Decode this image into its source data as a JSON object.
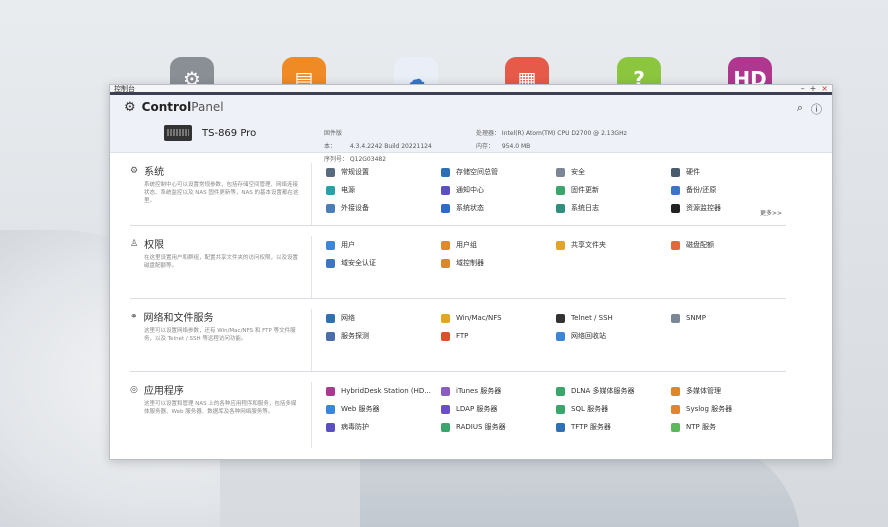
{
  "window": {
    "title": "控制台",
    "controls": [
      "–",
      "+",
      "×"
    ]
  },
  "header": {
    "app_title_bold": "Control",
    "app_title_light": "Panel",
    "search_icon": "search-icon",
    "help_icon": "help-icon",
    "device_name": "TS-869 Pro",
    "info_left": [
      {
        "key": "固件版本：",
        "value": "4.3.4.2242 Build 20221124"
      },
      {
        "key": "序列号：",
        "value": "Q12G03482"
      }
    ],
    "info_right": [
      {
        "key": "处理器：",
        "value": "Intel(R) Atom(TM) CPU D2700 @ 2.13GHz"
      },
      {
        "key": "内存：",
        "value": "954.0 MB"
      }
    ]
  },
  "sections": [
    {
      "id": "system",
      "icon": "gear-icon",
      "title": "系统",
      "desc": "系统控制中心可以设置常规参数，包括存储空间管理、网络连接状态、系统监控以及 NAS 固件更新等，NAS 的基本设置都在这里。",
      "items": [
        {
          "label": "常规设置",
          "color": "#5a6b7f"
        },
        {
          "label": "存储空间总管",
          "color": "#2f6fb3"
        },
        {
          "label": "安全",
          "color": "#7b8794"
        },
        {
          "label": "硬件",
          "color": "#4a5b6e"
        },
        {
          "label": "电源",
          "color": "#2aa1a8"
        },
        {
          "label": "通知中心",
          "color": "#5b4fc4"
        },
        {
          "label": "固件更新",
          "color": "#3aa66b"
        },
        {
          "label": "备份/还原",
          "color": "#3b74c9"
        },
        {
          "label": "外接设备",
          "color": "#4c7fb8"
        },
        {
          "label": "系统状态",
          "color": "#2d6cc0"
        },
        {
          "label": "系统日志",
          "color": "#2f8f7a"
        },
        {
          "label": "资源监控器",
          "color": "#222222"
        }
      ],
      "more": "更多>>"
    },
    {
      "id": "privilege",
      "icon": "user-icon",
      "title": "权限",
      "desc": "在这里设置用户和群组，配置共享文件夹的访问权限，以及设置磁盘配额等。",
      "items": [
        {
          "label": "用户",
          "color": "#3b86d9"
        },
        {
          "label": "用户组",
          "color": "#e08a2a"
        },
        {
          "label": "共享文件夹",
          "color": "#e0a52a"
        },
        {
          "label": "磁盘配额",
          "color": "#e06a3a"
        },
        {
          "label": "域安全认证",
          "color": "#3b74c9"
        },
        {
          "label": "域控制器",
          "color": "#e0862a"
        }
      ]
    },
    {
      "id": "network",
      "icon": "network-icon",
      "title": "网络和文件服务",
      "desc": "这里可以设置网络参数，还有 Win/Mac/NFS 和 FTP 等文件服务，以及 Telnet / SSH 等远程访问功能。",
      "items": [
        {
          "label": "网络",
          "color": "#2f6fb3"
        },
        {
          "label": "Win/Mac/NFS",
          "color": "#e0a52a"
        },
        {
          "label": "Telnet / SSH",
          "color": "#333333"
        },
        {
          "label": "SNMP",
          "color": "#7b8794"
        },
        {
          "label": "服务探测",
          "color": "#4a6ea8"
        },
        {
          "label": "FTP",
          "color": "#d9532a"
        },
        {
          "label": "网络回收站",
          "color": "#3b86d9"
        }
      ]
    },
    {
      "id": "applications",
      "icon": "apps-icon",
      "title": "应用程序",
      "desc": "这里可以设置和管理 NAS 上的各种应用程序和服务，包括多媒体服务器、Web 服务器、数据库及各种网络服务等。",
      "items": [
        {
          "label": "HybridDesk Station (HD...",
          "color": "#b0378f"
        },
        {
          "label": "iTunes 服务器",
          "color": "#8b5cc4"
        },
        {
          "label": "DLNA 多媒体服务器",
          "color": "#3aa66b"
        },
        {
          "label": "多媒体管理",
          "color": "#e0862a"
        },
        {
          "label": "Web 服务器",
          "color": "#3b86d9"
        },
        {
          "label": "LDAP 服务器",
          "color": "#6a4fc4"
        },
        {
          "label": "SQL 服务器",
          "color": "#3aa66b"
        },
        {
          "label": "Syslog 服务器",
          "color": "#e0862a"
        },
        {
          "label": "病毒防护",
          "color": "#5b4fc4"
        },
        {
          "label": "RADIUS 服务器",
          "color": "#3aa66b"
        },
        {
          "label": "TFTP 服务器",
          "color": "#2f6fb3"
        },
        {
          "label": "NTP 服务",
          "color": "#5cb85c"
        }
      ]
    }
  ],
  "desktop_icons": [
    {
      "name": "control-panel-desktop-icon",
      "color": "#8a8f96",
      "glyph": "⚙"
    },
    {
      "name": "file-station-desktop-icon",
      "color": "#f08a24",
      "glyph": "▤"
    },
    {
      "name": "cloud-desktop-icon",
      "color": "#e9eef7",
      "glyph": "☁"
    },
    {
      "name": "app-center-desktop-icon",
      "color": "#e65a4a",
      "glyph": "▦"
    },
    {
      "name": "help-desktop-icon",
      "color": "#8cc63f",
      "glyph": "?"
    },
    {
      "name": "hd-station-desktop-icon",
      "color": "#b0378f",
      "glyph": "HD"
    }
  ]
}
